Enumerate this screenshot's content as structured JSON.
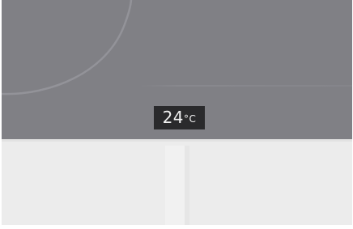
{
  "display": {
    "temperature_value": "24",
    "temperature_unit": "°C"
  },
  "colors": {
    "display_background": "#808085",
    "badge_background": "#2a2a2c",
    "badge_text": "#f2f2f2",
    "lower_panel": "#ececec"
  }
}
